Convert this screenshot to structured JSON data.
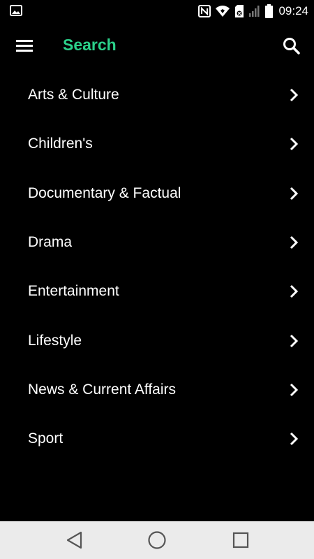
{
  "status_bar": {
    "time": "09:24",
    "icons": [
      "gallery-icon",
      "nfc-icon",
      "wifi-icon",
      "sim-icon",
      "signal-icon",
      "battery-icon"
    ]
  },
  "app_bar": {
    "title": "Search",
    "accent_color": "#2bd18a",
    "menu_icon": "hamburger-menu-icon",
    "search_icon": "search-icon"
  },
  "categories": [
    {
      "label": "Arts & Culture"
    },
    {
      "label": "Children's"
    },
    {
      "label": "Documentary & Factual"
    },
    {
      "label": "Drama"
    },
    {
      "label": "Entertainment"
    },
    {
      "label": "Lifestyle"
    },
    {
      "label": "News & Current Affairs"
    },
    {
      "label": "Sport"
    }
  ],
  "nav_bar": {
    "buttons": [
      "back-icon",
      "home-icon",
      "recent-apps-icon"
    ]
  }
}
